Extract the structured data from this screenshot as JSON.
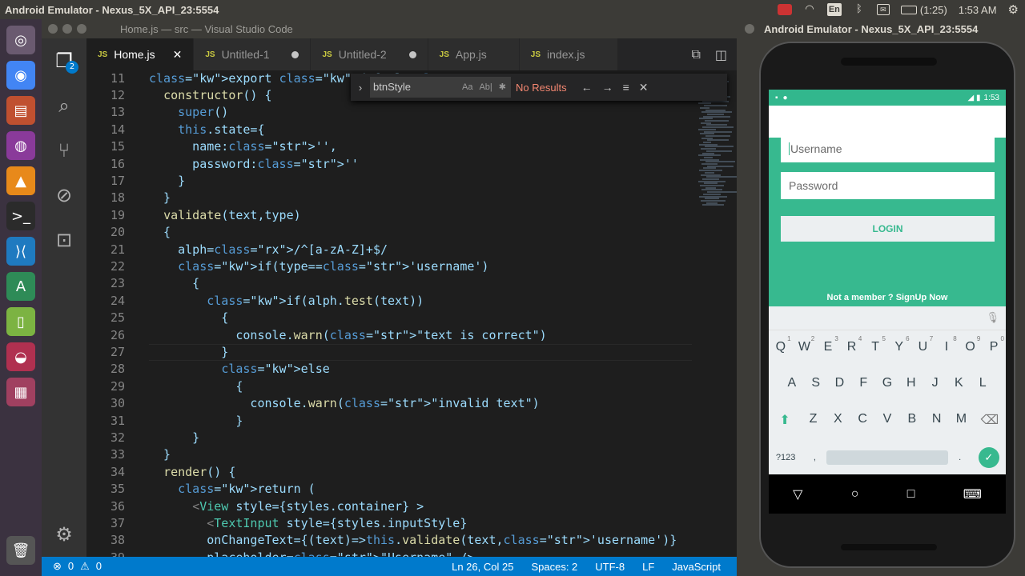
{
  "topbar": {
    "title": "Android Emulator - Nexus_5X_API_23:5554",
    "battery": "(1:25)",
    "clock": "1:53 AM",
    "kbd": "En"
  },
  "vscode": {
    "window_title": "Home.js — src — Visual Studio Code",
    "explorer_badge": "2",
    "tabs": [
      {
        "label": "Home.js",
        "active": true
      },
      {
        "label": "Untitled-1",
        "active": false
      },
      {
        "label": "Untitled-2",
        "active": false
      },
      {
        "label": "App.js",
        "active": false
      },
      {
        "label": "index.js",
        "active": false
      }
    ],
    "tab_icon": "JS",
    "find": {
      "query": "btnStyle",
      "result": "No Results",
      "opt_case": "Aa",
      "opt_word": "Ab|"
    },
    "code_lines": [
      {
        "n": "11",
        "t": "export default class "
      },
      {
        "n": "12",
        "t": "  constructor() {"
      },
      {
        "n": "13",
        "t": "    super()"
      },
      {
        "n": "14",
        "t": "    this.state={"
      },
      {
        "n": "15",
        "t": "      name:'', "
      },
      {
        "n": "16",
        "t": "      password:''"
      },
      {
        "n": "17",
        "t": "    }"
      },
      {
        "n": "18",
        "t": "  }"
      },
      {
        "n": "19",
        "t": "  validate(text,type)"
      },
      {
        "n": "20",
        "t": "  {"
      },
      {
        "n": "21",
        "t": "    alph=/^[a-zA-Z]+$/"
      },
      {
        "n": "22",
        "t": "    if(type=='username')"
      },
      {
        "n": "23",
        "t": "      {"
      },
      {
        "n": "24",
        "t": "        if(alph.test(text))"
      },
      {
        "n": "25",
        "t": "          {"
      },
      {
        "n": "26",
        "t": "            console.warn(\"text is correct\")"
      },
      {
        "n": "27",
        "t": "          }"
      },
      {
        "n": "28",
        "t": "          else"
      },
      {
        "n": "29",
        "t": "            {"
      },
      {
        "n": "30",
        "t": "              console.warn(\"invalid text\")"
      },
      {
        "n": "31",
        "t": "            }"
      },
      {
        "n": "32",
        "t": "      }"
      },
      {
        "n": "33",
        "t": "  }"
      },
      {
        "n": "34",
        "t": "  render() {"
      },
      {
        "n": "35",
        "t": "    return ("
      },
      {
        "n": "36",
        "t": "      <View style={styles.container} >"
      },
      {
        "n": "37",
        "t": "        <TextInput style={styles.inputStyle}"
      },
      {
        "n": "38",
        "t": "        onChangeText={(text)=>this.validate(text,'username')}"
      },
      {
        "n": "39",
        "t": "        placeholder=\"Username\" />"
      }
    ],
    "status": {
      "errors": "0",
      "warnings": "0",
      "position": "Ln 26, Col 25",
      "spaces": "Spaces: 2",
      "encoding": "UTF-8",
      "eol": "LF",
      "language": "JavaScript"
    }
  },
  "emulator": {
    "window_title": "Android Emulator - Nexus_5X_API_23:5554",
    "phone_time": "1:53",
    "username_placeholder": "Username",
    "password_placeholder": "Password",
    "login_label": "LOGIN",
    "signup_text": "Not a member ? SignUp Now",
    "keyboard": {
      "row1": [
        "Q",
        "W",
        "E",
        "R",
        "T",
        "Y",
        "U",
        "I",
        "O",
        "P"
      ],
      "row1_hints": [
        "1",
        "2",
        "3",
        "4",
        "5",
        "6",
        "7",
        "8",
        "9",
        "0"
      ],
      "row2": [
        "A",
        "S",
        "D",
        "F",
        "G",
        "H",
        "J",
        "K",
        "L"
      ],
      "row3": [
        "Z",
        "X",
        "C",
        "V",
        "B",
        "N",
        "M"
      ],
      "symbols": "?123",
      "comma": ",",
      "period": "."
    }
  },
  "colors": {
    "accent": "#007acc",
    "app_green": "#37b98f"
  }
}
